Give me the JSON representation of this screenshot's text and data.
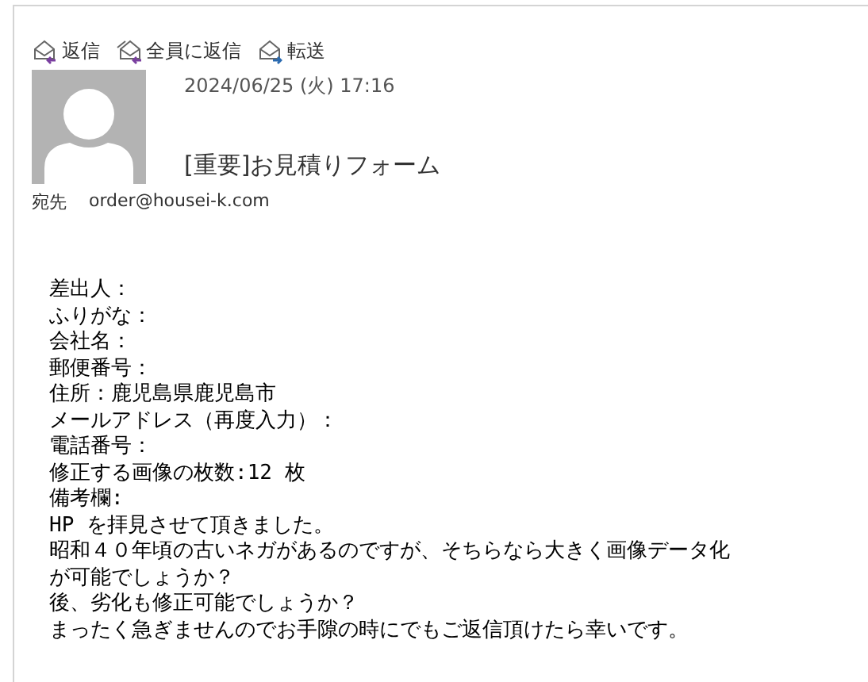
{
  "toolbar": [
    {
      "label": "返信",
      "kind": "reply"
    },
    {
      "label": "全員に返信",
      "kind": "reply-all"
    },
    {
      "label": "転送",
      "kind": "forward"
    }
  ],
  "message": {
    "date": "2024/06/25 (火) 17:16",
    "subject": "[重要]お見積りフォーム",
    "to_label": "宛先",
    "to": "order@housei-k.com"
  },
  "body": [
    "差出人：",
    "ふりがな：",
    "会社名：",
    "郵便番号：",
    "住所：鹿児島県鹿児島市",
    "メールアドレス（再度入力）：",
    "電話番号：",
    "修正する画像の枚数:12 枚",
    "備考欄:",
    "HP を拝見させて頂きました。",
    "昭和４０年頃の古いネガがあるのですが、そちらなら大きく画像データ化",
    "が可能でしょうか？",
    "後、劣化も修正可能でしょうか？",
    "まったく急ぎませんのでお手隙の時にでもご返信頂けたら幸いです。"
  ]
}
